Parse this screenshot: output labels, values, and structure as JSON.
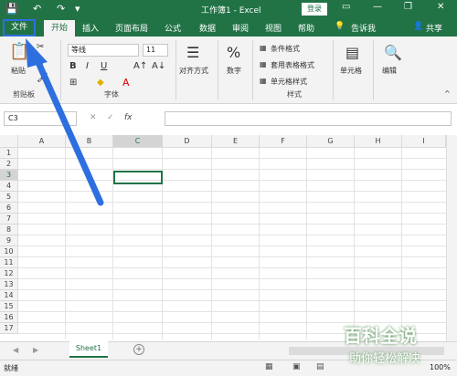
{
  "titlebar": {
    "title": "工作簿1 - Excel",
    "login": "登录",
    "window_controls": {
      "minimize": "—",
      "restore": "❐",
      "close": "✕"
    }
  },
  "tabs": {
    "file": "文件",
    "items": [
      "开始",
      "插入",
      "页面布局",
      "公式",
      "数据",
      "审阅",
      "视图",
      "帮助"
    ],
    "tell_me": "告诉我",
    "share": "共享"
  },
  "ribbon": {
    "clipboard": {
      "paste": "粘贴",
      "label": "剪贴板"
    },
    "font": {
      "font_name": "等线",
      "font_size": "11",
      "label": "字体"
    },
    "alignment": {
      "label": "对齐方式"
    },
    "number": {
      "label": "数字"
    },
    "styles": {
      "conditional": "条件格式",
      "table_format": "套用表格格式",
      "cell_styles": "单元格样式",
      "label": "样式"
    },
    "cells": {
      "label": "单元格"
    },
    "editing": {
      "label": "编辑"
    }
  },
  "formula_bar": {
    "name_box": "C3",
    "fx": "fx",
    "value": ""
  },
  "grid": {
    "columns": [
      "A",
      "B",
      "C",
      "D",
      "E",
      "F",
      "G",
      "H",
      "I"
    ],
    "rows": [
      "1",
      "2",
      "3",
      "4",
      "5",
      "6",
      "7",
      "8",
      "9",
      "10",
      "11",
      "12",
      "13",
      "14",
      "15",
      "16",
      "17"
    ],
    "selected": "C3"
  },
  "sheets": {
    "tabs": [
      "Sheet1"
    ],
    "add": "+"
  },
  "status": {
    "text": "就绪",
    "zoom": "100%"
  },
  "watermark": {
    "line1": "百科全说",
    "line2": "助你轻松解决"
  },
  "colors": {
    "excel_green": "#217346",
    "arrow_blue": "#2e6fe0"
  }
}
